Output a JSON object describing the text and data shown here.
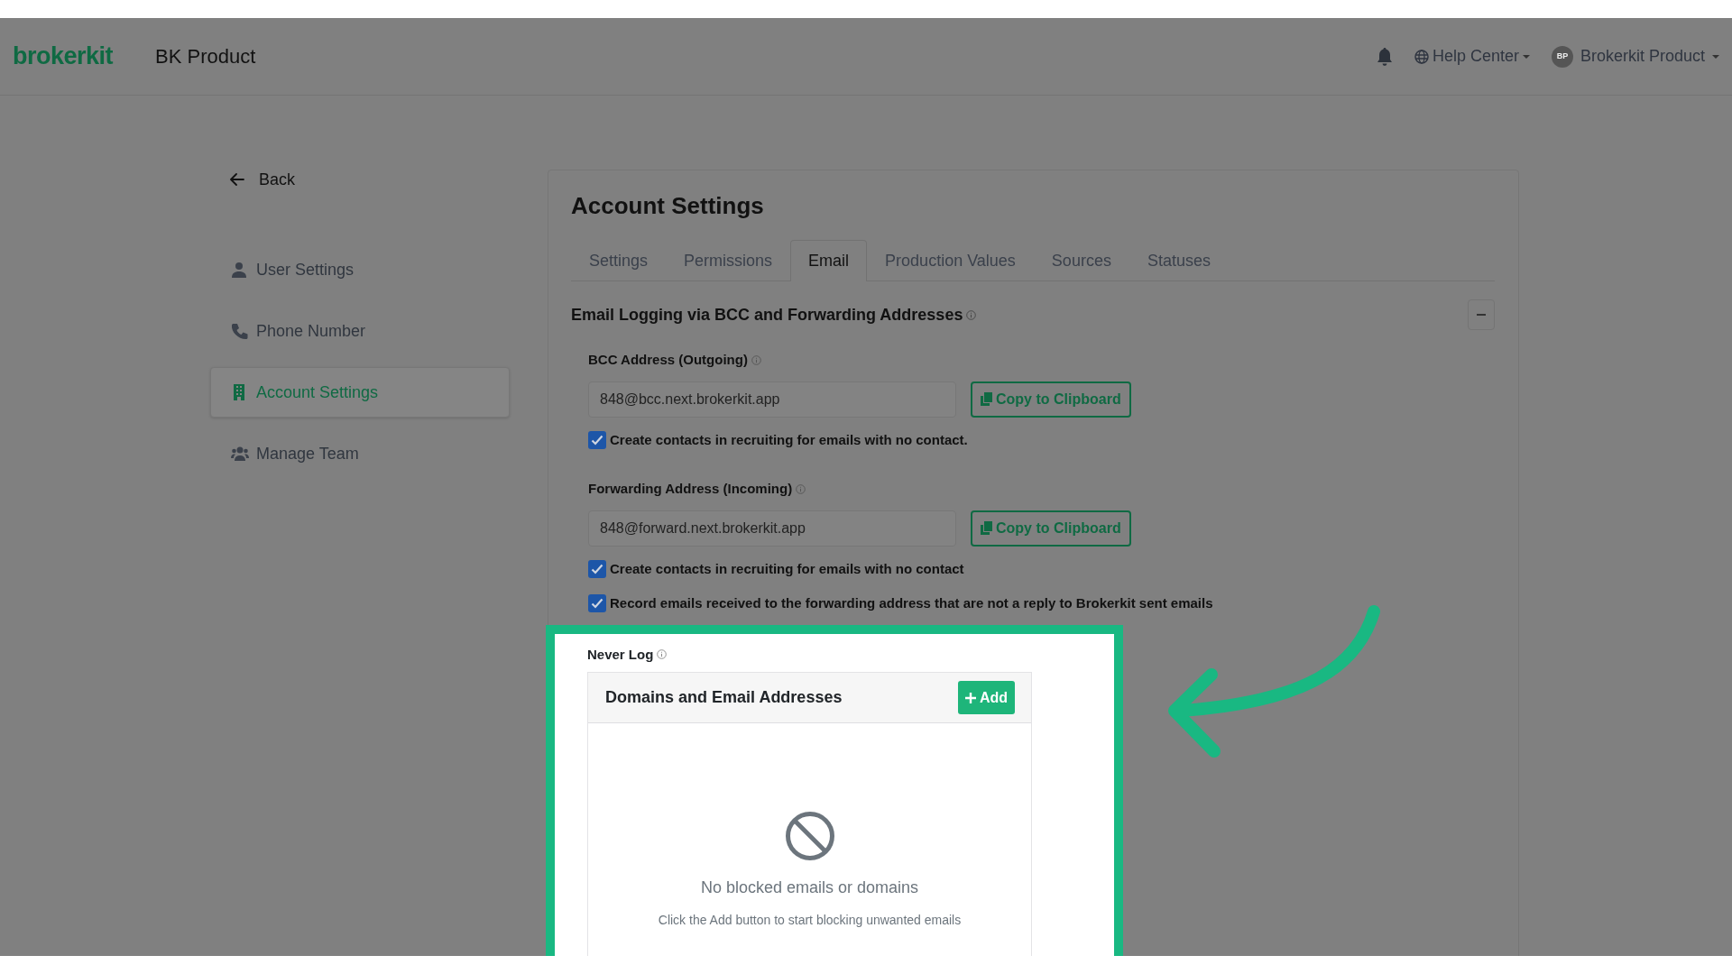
{
  "header": {
    "logo": "brokerkit",
    "product": "BK Product",
    "help": "Help Center",
    "avatar": "BP",
    "user": "Brokerkit Product"
  },
  "sidebar": {
    "back": "Back",
    "items": [
      {
        "label": "User Settings",
        "selected": false
      },
      {
        "label": "Phone Number",
        "selected": false
      },
      {
        "label": "Account Settings",
        "selected": true
      },
      {
        "label": "Manage Team",
        "selected": false
      }
    ]
  },
  "page": {
    "title": "Account Settings",
    "tabs": [
      {
        "label": "Settings",
        "selected": false
      },
      {
        "label": "Permissions",
        "selected": false
      },
      {
        "label": "Email",
        "selected": true
      },
      {
        "label": "Production Values",
        "selected": false
      },
      {
        "label": "Sources",
        "selected": false
      },
      {
        "label": "Statuses",
        "selected": false
      }
    ]
  },
  "section": {
    "title": "Email Logging via BCC and Forwarding Addresses",
    "expanded": true
  },
  "addresses": [
    {
      "label": "BCC Address (Outgoing)",
      "value": "848@bcc.next.brokerkit.app",
      "button": "Copy to Clipboard",
      "options": [
        {
          "label": "Create contacts in recruiting for emails with no contact.",
          "checked": true
        }
      ]
    },
    {
      "label": "Forwarding Address (Incoming)",
      "value": "848@forward.next.brokerkit.app",
      "button": "Copy to Clipboard",
      "options": [
        {
          "label": "Create contacts in recruiting for emails with no contact",
          "checked": true
        },
        {
          "label": "Record emails received to the forwarding address that are not a reply to Brokerkit sent emails",
          "checked": true
        }
      ]
    }
  ],
  "never_log": {
    "label": "Never Log",
    "highlighted": true,
    "table_title": "Domains and Email Addresses",
    "add_button": "Add",
    "empty_title": "No blocked emails or domains",
    "empty_text": "Click the Add button to start blocking unwanted emails"
  }
}
